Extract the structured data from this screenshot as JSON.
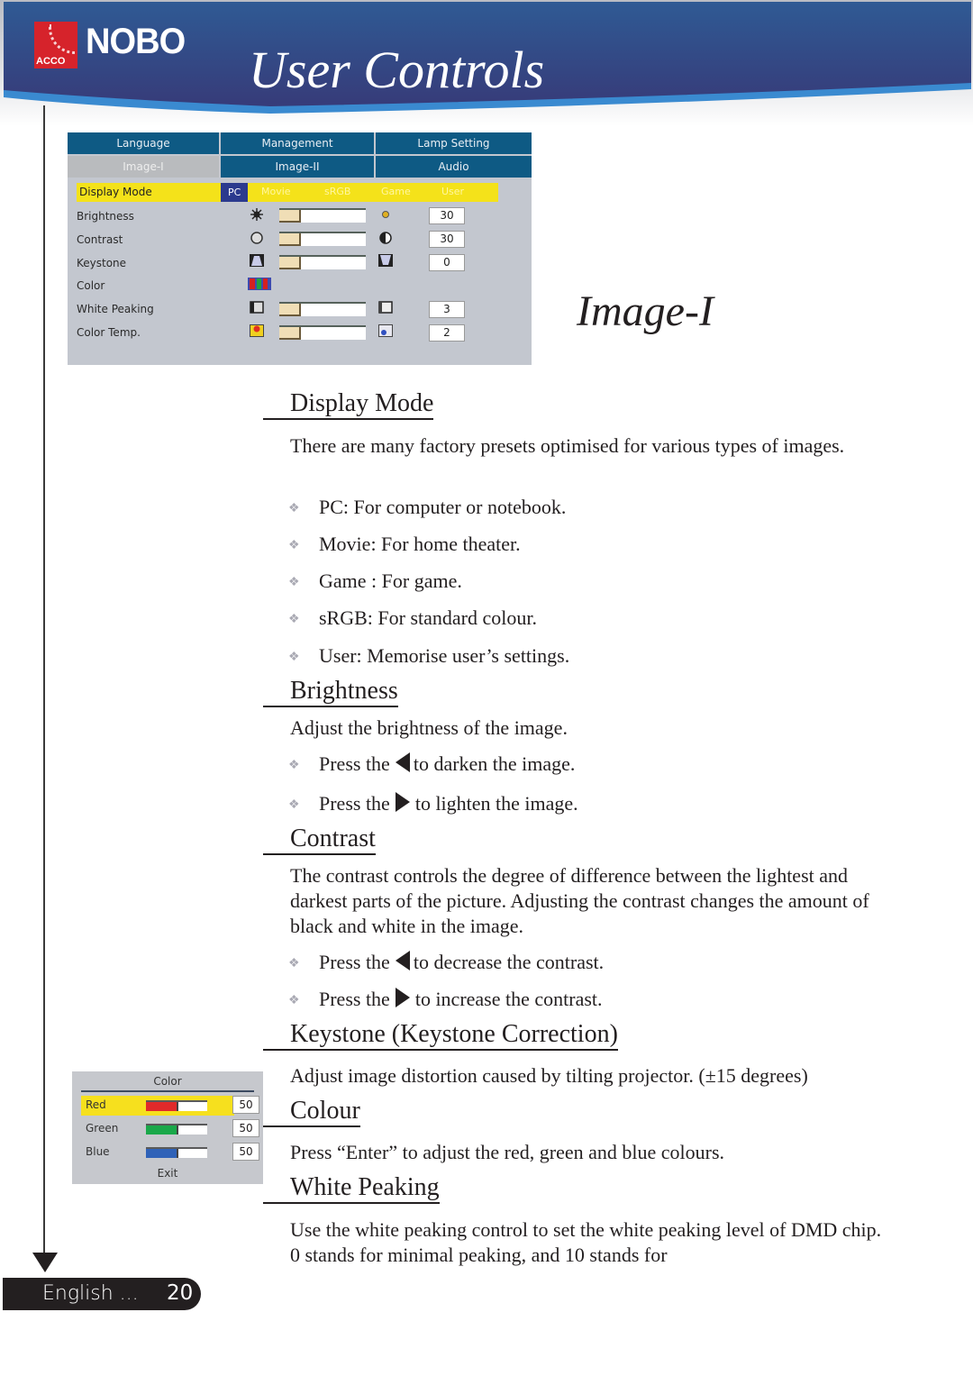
{
  "header": {
    "brand": "NOBO",
    "brand_sub": "ACCO",
    "title": "User Controls",
    "colors": {
      "banner": "#2e4a8a",
      "banner_stripe": "#3a8ad0",
      "logo_red": "#d6232b"
    }
  },
  "osd_menu": {
    "tabs_row1": [
      "Language",
      "Management",
      "Lamp Setting"
    ],
    "tabs_row2": [
      "Image-I",
      "Image-II",
      "Audio"
    ],
    "active_tab": "Image-I",
    "display_mode": {
      "label": "Display Mode",
      "options": [
        "PC",
        "Movie",
        "sRGB",
        "Game",
        "User"
      ],
      "selected": "PC"
    },
    "rows": [
      {
        "label": "Brightness",
        "value": "30",
        "level": 0.25,
        "icon_left": "sun-dim-icon",
        "icon_right": "sun-bright-icon"
      },
      {
        "label": "Contrast",
        "value": "30",
        "level": 0.25,
        "icon_left": "contrast-low-icon",
        "icon_right": "contrast-high-icon"
      },
      {
        "label": "Keystone",
        "value": "0",
        "level": 0.25,
        "icon_left": "keystone-up-icon",
        "icon_right": "keystone-down-icon"
      },
      {
        "label": "Color",
        "value": null,
        "icon_left": "rgb-bars-icon"
      },
      {
        "label": "White Peaking",
        "value": "3",
        "level": 0.25,
        "icon_left": "peaking-low-icon",
        "icon_right": "peaking-high-icon"
      },
      {
        "label": "Color Temp.",
        "value": "2",
        "level": 0.25,
        "icon_left": "warm-temp-icon",
        "icon_right": "cool-temp-icon"
      }
    ],
    "colors": {
      "tab_bg": "#0e5a84",
      "panel_bg": "#c3c7cf",
      "highlight": "#f4e21a",
      "selected_bg": "#2b3a8e"
    }
  },
  "section_title": "Image-I",
  "sections": {
    "display_mode": {
      "heading": "Display Mode",
      "intro": "There are many factory presets optimised for various types of images.",
      "bullets": [
        "PC: For computer or notebook.",
        "Movie: For home theater.",
        "Game : For game.",
        "sRGB: For standard colour.",
        "User: Memorise user’s settings."
      ]
    },
    "brightness": {
      "heading": "Brightness",
      "intro": "Adjust the brightness of the image.",
      "bullets": [
        {
          "pre": "Press the",
          "post": "to darken the image.",
          "arrow": "left"
        },
        {
          "pre": "Press the",
          "post": "to lighten the image.",
          "arrow": "right"
        }
      ]
    },
    "contrast": {
      "heading": "Contrast",
      "intro": "The contrast controls the degree of difference between the lightest and darkest parts of the picture. Adjusting the contrast changes the amount of black and white in the image.",
      "bullets": [
        {
          "pre": "Press the",
          "post": "to decrease the contrast.",
          "arrow": "left"
        },
        {
          "pre": "Press the",
          "post": "to increase the contrast.",
          "arrow": "right"
        }
      ]
    },
    "keystone": {
      "heading": "Keystone (Keystone Correction)",
      "intro": "Adjust image distortion caused by tilting projector. (±15 degrees)"
    },
    "colour": {
      "heading": "Colour",
      "intro": "Press “Enter” to adjust the red, green and blue colours."
    },
    "white_peaking": {
      "heading": "White Peaking",
      "intro": "Use the white peaking control to set the white peaking level of DMD chip. 0 stands for minimal peaking, and 10 stands for"
    }
  },
  "color_menu": {
    "title": "Color",
    "rows": [
      {
        "label": "Red",
        "value": "50",
        "level": 0.5,
        "color": "#e02a2a"
      },
      {
        "label": "Green",
        "value": "50",
        "level": 0.5,
        "color": "#1aa84a"
      },
      {
        "label": "Blue",
        "value": "50",
        "level": 0.5,
        "color": "#2f62b8"
      }
    ],
    "highlighted": "Red",
    "exit_label": "Exit"
  },
  "footer": {
    "language": "English ...",
    "page_number": "20"
  }
}
